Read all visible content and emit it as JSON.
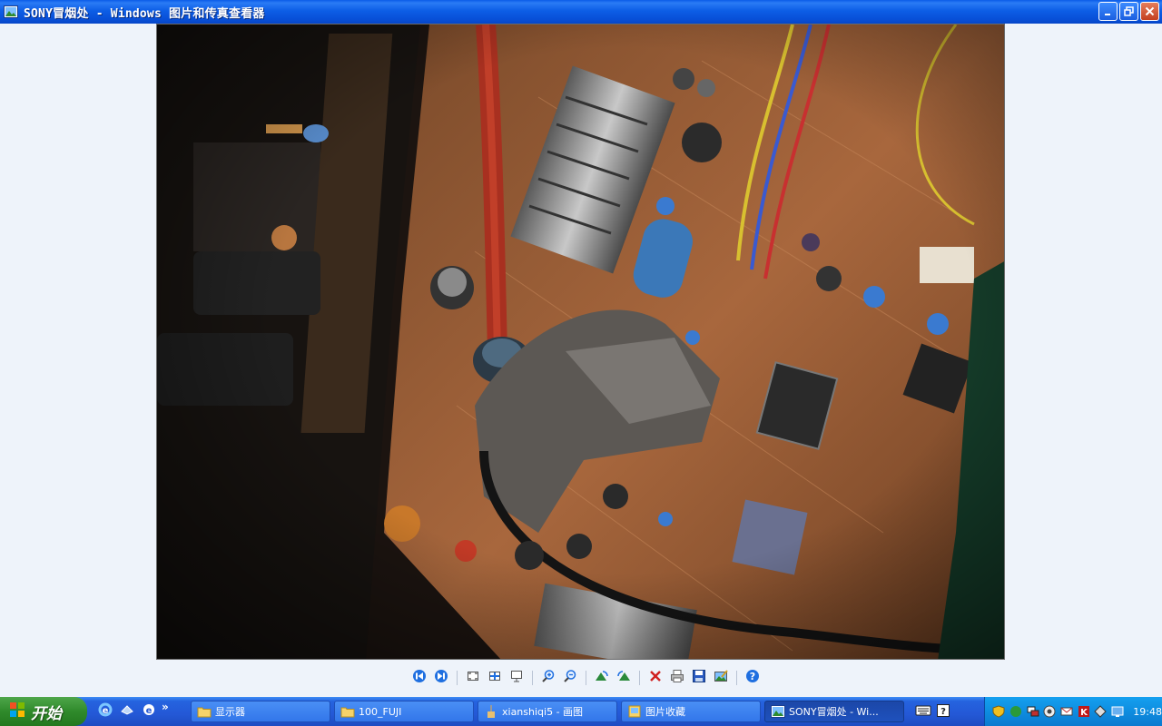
{
  "window": {
    "title": "SONY冒烟处 - Windows 图片和传真查看器",
    "title_bar_color": "#0a5be8"
  },
  "photo": {
    "subject": "crt-circuit-board-photo"
  },
  "toolbar": {
    "buttons": [
      {
        "name": "previous-image",
        "icon": "prev-icon"
      },
      {
        "name": "next-image",
        "icon": "next-icon"
      },
      {
        "name": "best-fit",
        "icon": "best-fit-icon"
      },
      {
        "name": "actual-size",
        "icon": "actual-size-icon"
      },
      {
        "name": "slideshow",
        "icon": "slideshow-icon"
      },
      {
        "name": "zoom-in",
        "icon": "zoom-in-icon"
      },
      {
        "name": "zoom-out",
        "icon": "zoom-out-icon"
      },
      {
        "name": "rotate-clockwise",
        "icon": "rotate-cw-icon"
      },
      {
        "name": "rotate-counterclockwise",
        "icon": "rotate-ccw-icon"
      },
      {
        "name": "delete",
        "icon": "delete-icon"
      },
      {
        "name": "print",
        "icon": "print-icon"
      },
      {
        "name": "copy-to",
        "icon": "save-icon"
      },
      {
        "name": "edit",
        "icon": "edit-icon"
      },
      {
        "name": "help",
        "icon": "help-icon"
      }
    ]
  },
  "taskbar": {
    "start_label": "开始",
    "quick_launch_more": "»",
    "tasks": [
      {
        "label": "显示器",
        "icon": "folder-icon",
        "active": false
      },
      {
        "label": "100_FUJI",
        "icon": "folder-icon",
        "active": false
      },
      {
        "label": "xianshiqi5 - 画图",
        "icon": "paint-icon",
        "active": false
      },
      {
        "label": "图片收藏",
        "icon": "pictures-icon",
        "active": false
      },
      {
        "label": "SONY冒烟处 - Wi...",
        "icon": "image-viewer-icon",
        "active": true
      }
    ],
    "clock": "19:48"
  }
}
